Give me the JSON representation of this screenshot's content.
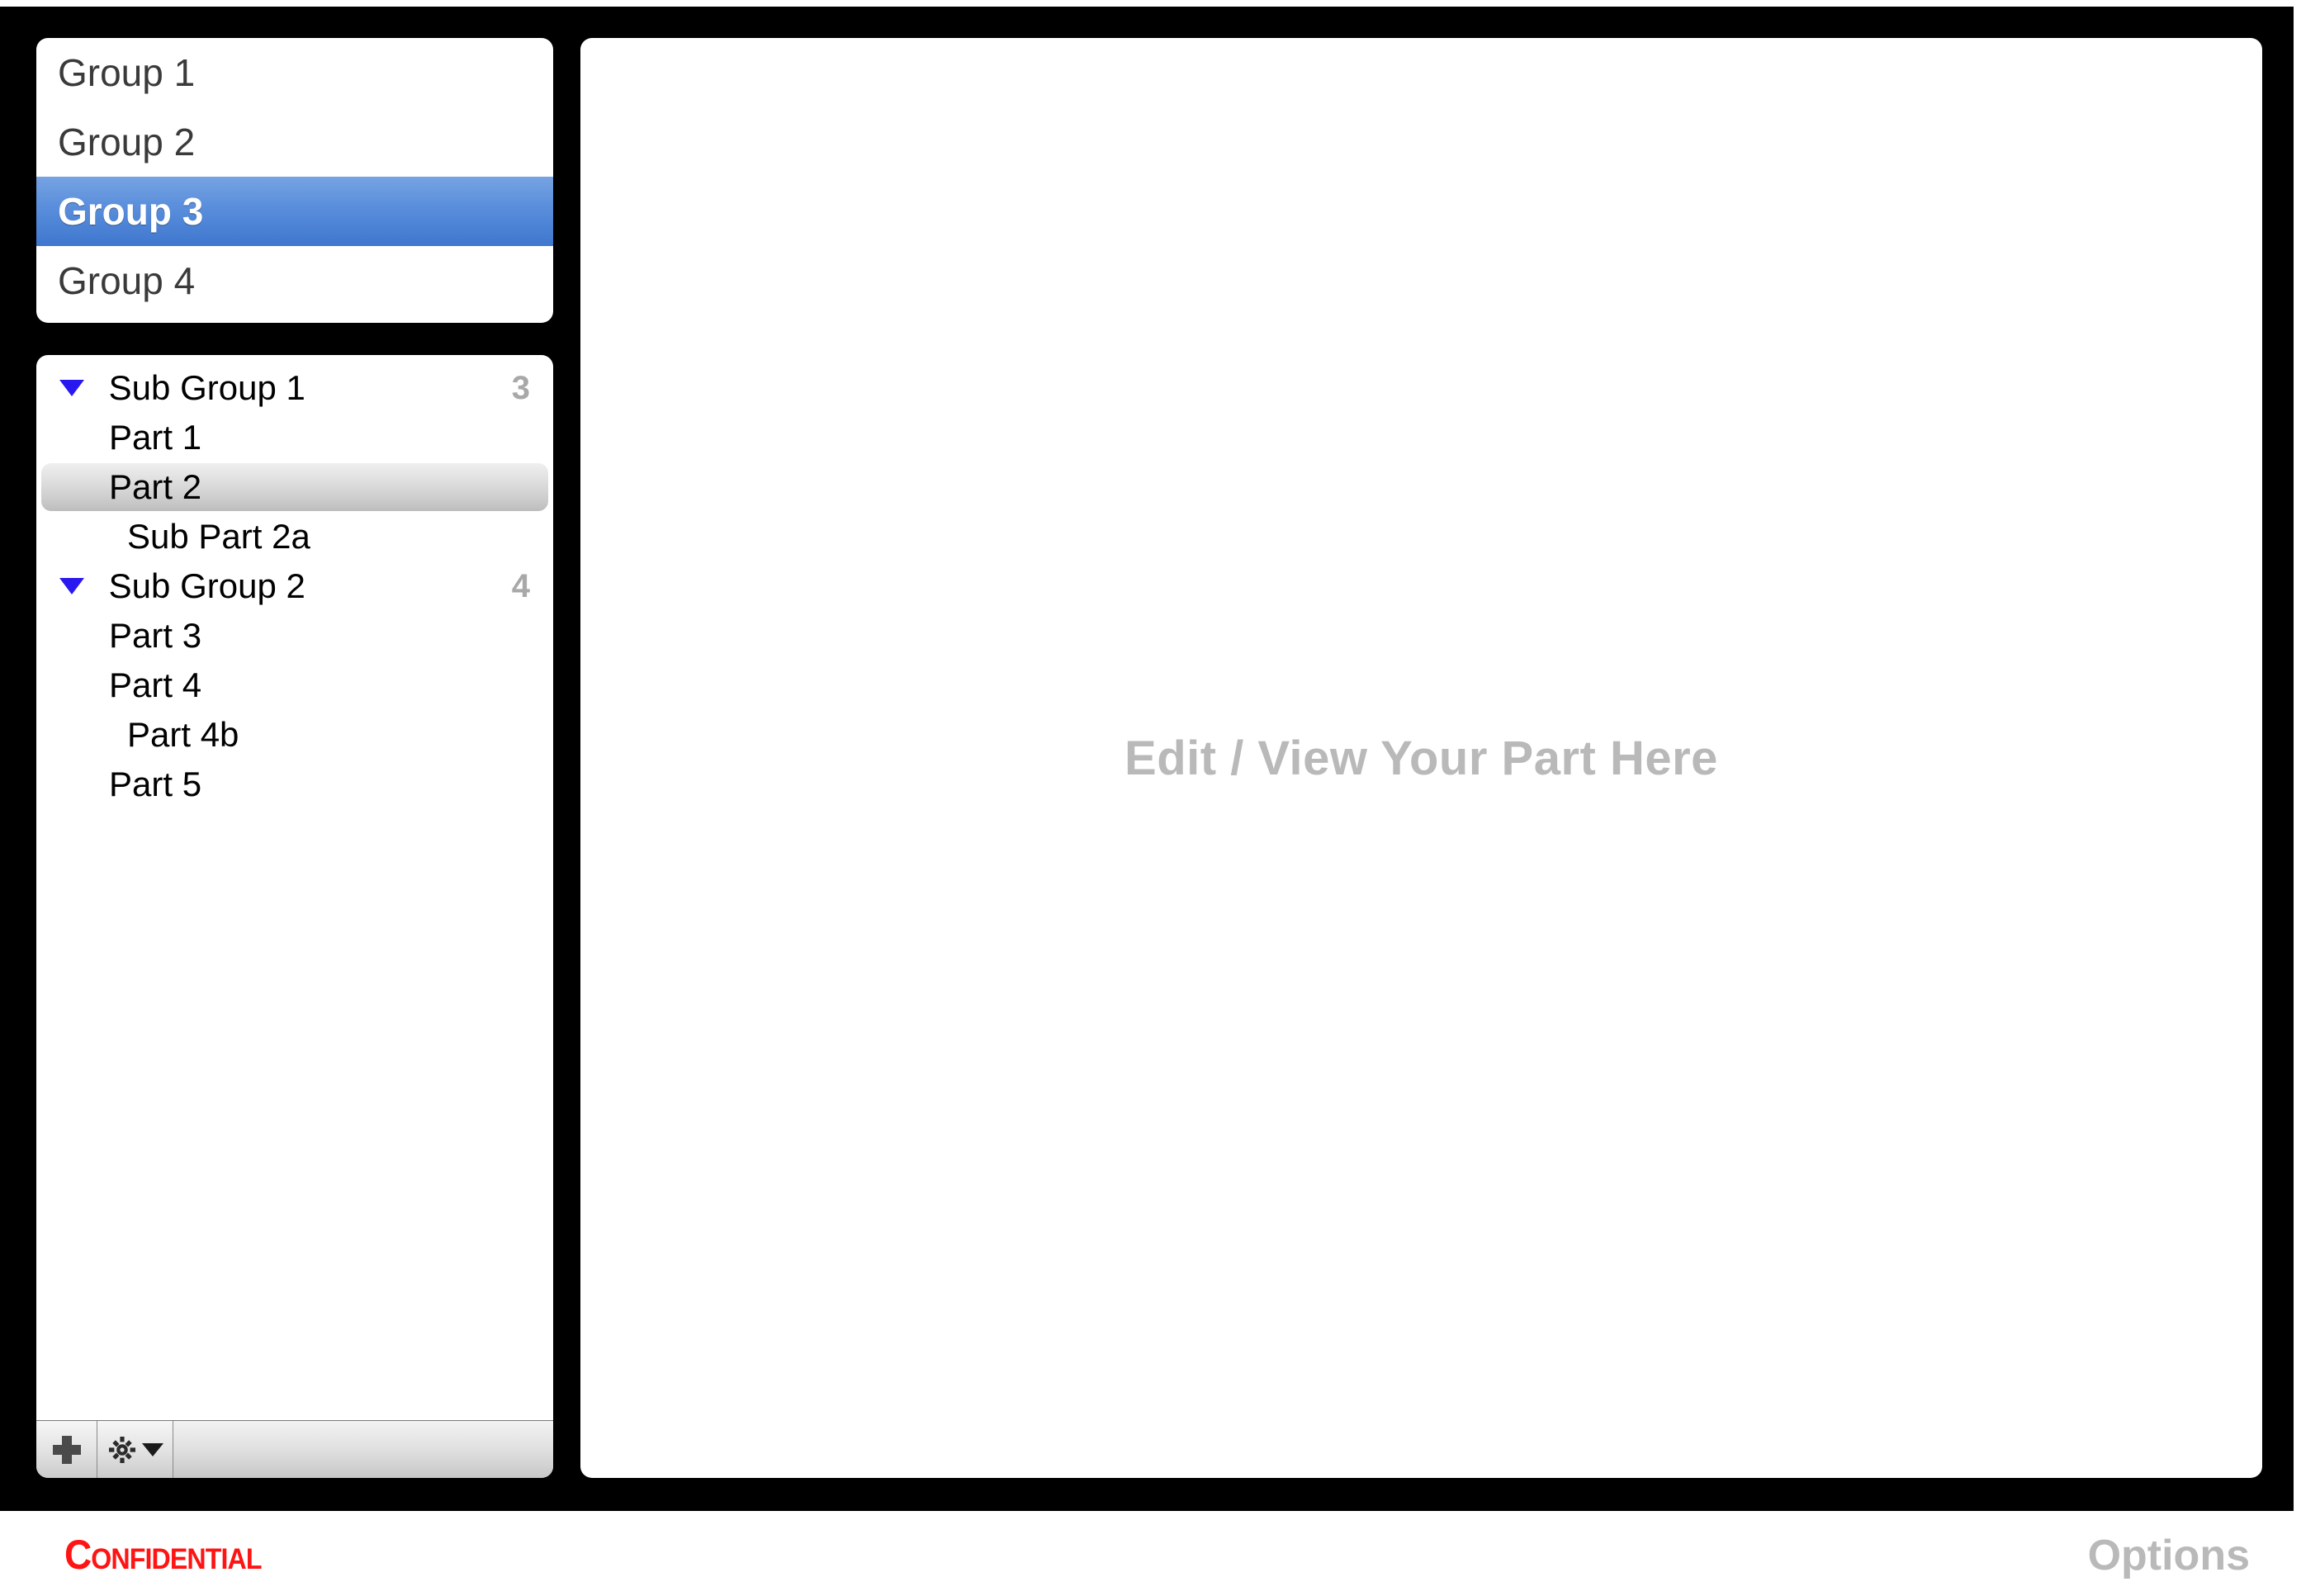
{
  "window": {
    "frame_color": "#000000",
    "panel_background": "#ffffff"
  },
  "group_list": {
    "selected_index": 2,
    "selected_color": "#3f77cf",
    "items": [
      {
        "label": "Group 1",
        "selected": false
      },
      {
        "label": "Group 2",
        "selected": false
      },
      {
        "label": "Group 3",
        "selected": true
      },
      {
        "label": "Group 4",
        "selected": false
      }
    ]
  },
  "tree": {
    "disclosure_color": "#2a18f0",
    "count_color": "#a8a8a8",
    "rows": [
      {
        "label": "Sub Group 1",
        "level": "group",
        "count": "3",
        "expanded": true,
        "selected": false
      },
      {
        "label": "Part 1",
        "level": "part",
        "count": "",
        "expanded": null,
        "selected": false
      },
      {
        "label": "Part 2",
        "level": "part",
        "count": "",
        "expanded": null,
        "selected": true
      },
      {
        "label": "Sub Part 2a",
        "level": "sub",
        "count": "",
        "expanded": null,
        "selected": false
      },
      {
        "label": "Sub Group 2",
        "level": "group",
        "count": "4",
        "expanded": true,
        "selected": false
      },
      {
        "label": "Part 3",
        "level": "part",
        "count": "",
        "expanded": null,
        "selected": false
      },
      {
        "label": "Part 4",
        "level": "part",
        "count": "",
        "expanded": null,
        "selected": false
      },
      {
        "label": "Part 4b",
        "level": "sub",
        "count": "",
        "expanded": null,
        "selected": false
      },
      {
        "label": "Part 5",
        "level": "part",
        "count": "",
        "expanded": null,
        "selected": false
      }
    ]
  },
  "toolbar": {
    "add_icon": "plus-icon",
    "settings_icon": "gear-icon",
    "settings_caret_icon": "caret-down-icon"
  },
  "main": {
    "placeholder": "Edit / View Your Part Here",
    "placeholder_color": "#b9b9b9"
  },
  "footer": {
    "confidential": "Confidential",
    "confidential_color": "#ff1414",
    "options": "Options",
    "options_color": "#b9b9b9"
  }
}
